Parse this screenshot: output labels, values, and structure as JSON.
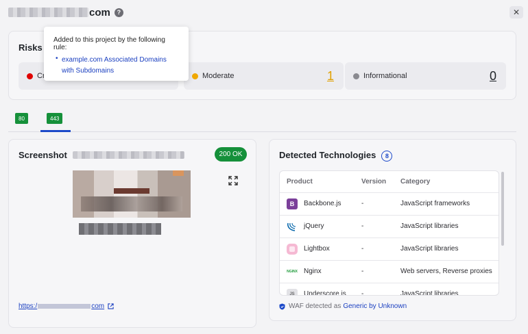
{
  "header": {
    "title_suffix": "com",
    "help_icon": "question-circle-icon",
    "close_icon": "close-icon"
  },
  "risks": {
    "title": "Risks",
    "items": [
      {
        "label": "Cr",
        "color": "#e00000",
        "count": ""
      },
      {
        "label": "Moderate",
        "color": "#f0a800",
        "count": "1"
      },
      {
        "label": "Informational",
        "color": "#8a8a90",
        "count": "0"
      }
    ]
  },
  "tooltip": {
    "title": "Added to this project by the following rule:",
    "link": "example.com Associated Domains with Subdomains"
  },
  "tabs": [
    {
      "label": "80",
      "active": false
    },
    {
      "label": "443",
      "active": true
    }
  ],
  "screenshot": {
    "title": "Screenshot",
    "status": "200 OK",
    "expand_icon": "expand-icon",
    "link_prefix": "https:/",
    "link_suffix": "com",
    "external_icon": "external-link-icon"
  },
  "technologies": {
    "title": "Detected Technologies",
    "count": "8",
    "columns": [
      "Product",
      "Version",
      "Category"
    ],
    "rows": [
      {
        "icon": "backbone-icon",
        "icon_text": "B",
        "icon_color": "#7b3f9a",
        "product": "Backbone.js",
        "version": "-",
        "category": "JavaScript frameworks"
      },
      {
        "icon": "jquery-icon",
        "icon_text": "",
        "icon_color": "#0868ac",
        "product": "jQuery",
        "version": "-",
        "category": "JavaScript libraries"
      },
      {
        "icon": "lightbox-icon",
        "icon_text": "",
        "icon_color": "#f0a6c8",
        "product": "Lightbox",
        "version": "-",
        "category": "JavaScript libraries"
      },
      {
        "icon": "nginx-icon",
        "icon_text": "NGINX",
        "icon_color": "#1e9b3a",
        "product": "Nginx",
        "version": "-",
        "category": "Web servers, Reverse proxies"
      },
      {
        "icon": "underscore-icon",
        "icon_text": "JS",
        "icon_color": "#c8c8cc",
        "product": "Underscore.js",
        "version": "-",
        "category": "JavaScript libraries"
      }
    ],
    "waf_prefix": "WAF detected as",
    "waf_link": "Generic by Unknown"
  }
}
